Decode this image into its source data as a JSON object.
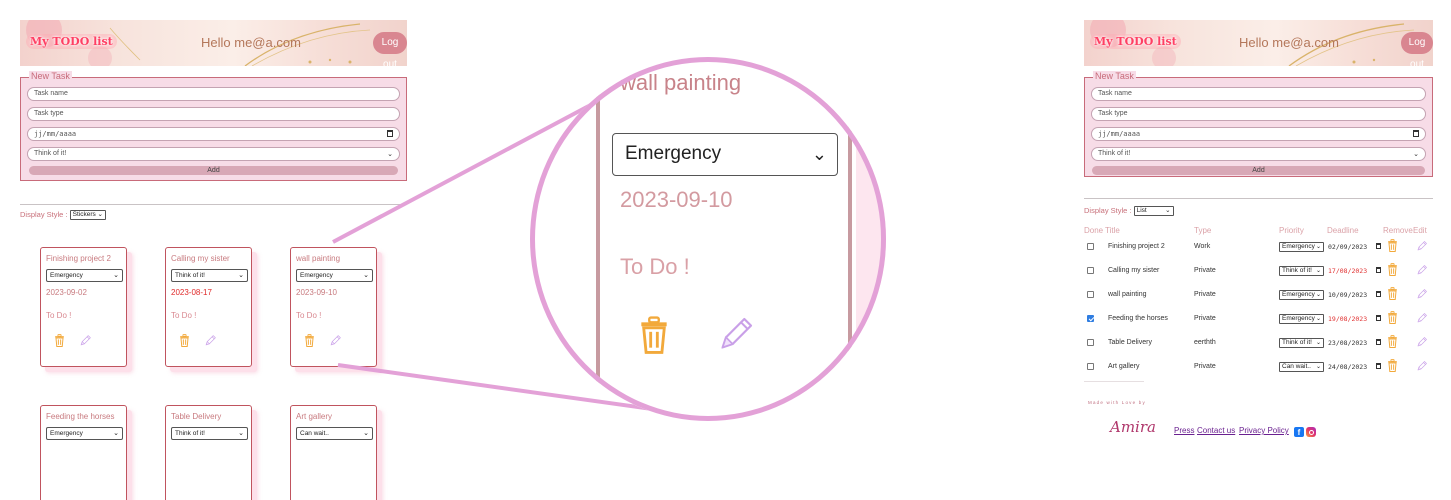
{
  "left_app": {
    "logo": "My TODO list",
    "hello": "Hello me@a.com",
    "logout": "Log out",
    "new_task": {
      "legend": "New Task",
      "task_name_placeholder": "Task name",
      "task_type_placeholder": "Task type",
      "date_placeholder": "jj/mm/aaaa",
      "priority_selected": "Think of it!",
      "add_label": "Add"
    },
    "display_style_label": "Display Style :",
    "display_style_value": "Stickers",
    "stickers": [
      {
        "title": "Finishing project 2",
        "priority": "Emergency",
        "date": "2023-09-02",
        "late": false,
        "status": "To Do !"
      },
      {
        "title": "Calling my sister",
        "priority": "Think of it!",
        "date": "2023-08-17",
        "late": true,
        "status": "To Do !"
      },
      {
        "title": "wall painting",
        "priority": "Emergency",
        "date": "2023-09-10",
        "late": false,
        "status": "To Do !"
      },
      {
        "title": "Feeding the horses",
        "priority": "Emergency"
      },
      {
        "title": "Table Delivery",
        "priority": "Think of it!"
      },
      {
        "title": "Art gallery",
        "priority": "Can wait.."
      }
    ]
  },
  "zoom": {
    "title": "wall painting",
    "priority": "Emergency",
    "date": "2023-09-10",
    "status": "To Do !"
  },
  "right_app": {
    "logo": "My TODO list",
    "hello": "Hello me@a.com",
    "logout": "Log out",
    "new_task": {
      "legend": "New Task",
      "task_name_placeholder": "Task name",
      "task_type_placeholder": "Task type",
      "date_placeholder": "jj/mm/aaaa",
      "priority_selected": "Think of it!",
      "add_label": "Add"
    },
    "display_style_label": "Display Style :",
    "display_style_value": "List",
    "columns": [
      "Done",
      "Title",
      "Type",
      "Priority",
      "Deadline",
      "Remove",
      "Edit"
    ],
    "rows": [
      {
        "done": false,
        "title": "Finishing project 2",
        "type": "Work",
        "priority": "Emergency",
        "deadline": "02/09/2023",
        "late": false
      },
      {
        "done": false,
        "title": "Calling my sister",
        "type": "Private",
        "priority": "Think of it!",
        "deadline": "17/08/2023",
        "late": true
      },
      {
        "done": false,
        "title": "wall painting",
        "type": "Private",
        "priority": "Emergency",
        "deadline": "10/09/2023",
        "late": false
      },
      {
        "done": true,
        "title": "Feeding the horses",
        "type": "Private",
        "priority": "Emergency",
        "deadline": "19/08/2023",
        "late": true
      },
      {
        "done": false,
        "title": "Table Delivery",
        "type": "eerthth",
        "priority": "Think of it!",
        "deadline": "23/08/2023",
        "late": false
      },
      {
        "done": false,
        "title": "Art gallery",
        "type": "Private",
        "priority": "Can wait..",
        "deadline": "24/08/2023",
        "late": false
      }
    ],
    "footer": {
      "made_with": "Made with Love by",
      "signature": "Amira",
      "links": [
        "Press",
        "Contact us",
        "Privacy Policy"
      ]
    }
  },
  "colors": {
    "accent_pink": "#e3a1d7",
    "sticker_border": "#c0545e",
    "late_date": "#e02a2a",
    "trash": "#f2a93b",
    "pencil": "#c9a0e8"
  },
  "icons": [
    "trash-icon",
    "pencil-icon",
    "calendar-icon",
    "chevron-down-icon",
    "facebook-icon",
    "instagram-icon"
  ]
}
